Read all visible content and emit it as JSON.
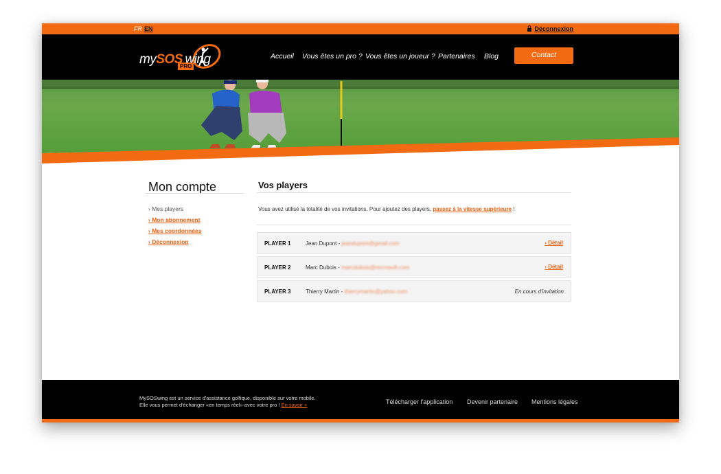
{
  "topbar": {
    "lang_fr": "FR",
    "lang_en": "EN",
    "logout_label": "Déconnexion"
  },
  "header": {
    "logo_my": "my",
    "logo_sos": "SOS",
    "logo_swing": "wing",
    "logo_pro": "PRO",
    "nav": [
      "Accueil",
      "Vous êtes un pro ?",
      "Vous êtes un joueur ?",
      "Partenaires",
      "Blog"
    ],
    "contact_label": "Contact"
  },
  "sidebar": {
    "title": "Mon compte",
    "items": [
      {
        "label": "Mes players",
        "active": true
      },
      {
        "label": "Mon abonnement"
      },
      {
        "label": "Mes coordonnées"
      },
      {
        "label": "Déconnexion"
      }
    ]
  },
  "main": {
    "title": "Vos players",
    "info_text": "Vous avez utilisé la totalité de vos invitations. Pour ajoutez des players,",
    "info_link": "passez à la vitesse supérieure",
    "info_suffix": "!",
    "players": [
      {
        "label": "PLAYER 1",
        "name": "Jean Dupont -",
        "email": "jeandupont@gmail.com",
        "action": "Détail"
      },
      {
        "label": "PLAYER 2",
        "name": "Marc Dubois -",
        "email": "marcdubois@microsoft.com",
        "action": "Détail"
      },
      {
        "label": "PLAYER 3",
        "name": "Thierry Martin -",
        "email": "thierrymartin@yahoo.com",
        "status": "En cours d'invitation"
      }
    ]
  },
  "footer": {
    "text_line1": "MySOSwing est un service d'assistance golfique, disponible sur votre mobile.",
    "text_line2": "Elle vous permet d'échanger «en temps réel» avec votre pro !",
    "learn_more": "En savoir +",
    "links": [
      "Télécharger l'application",
      "Devenir partenaire",
      "Mentions légales"
    ]
  },
  "colors": {
    "accent": "#f26a12",
    "dark": "#000000"
  },
  "icons": {
    "lock": "lock-icon",
    "chevron": "chevron-right-icon"
  }
}
